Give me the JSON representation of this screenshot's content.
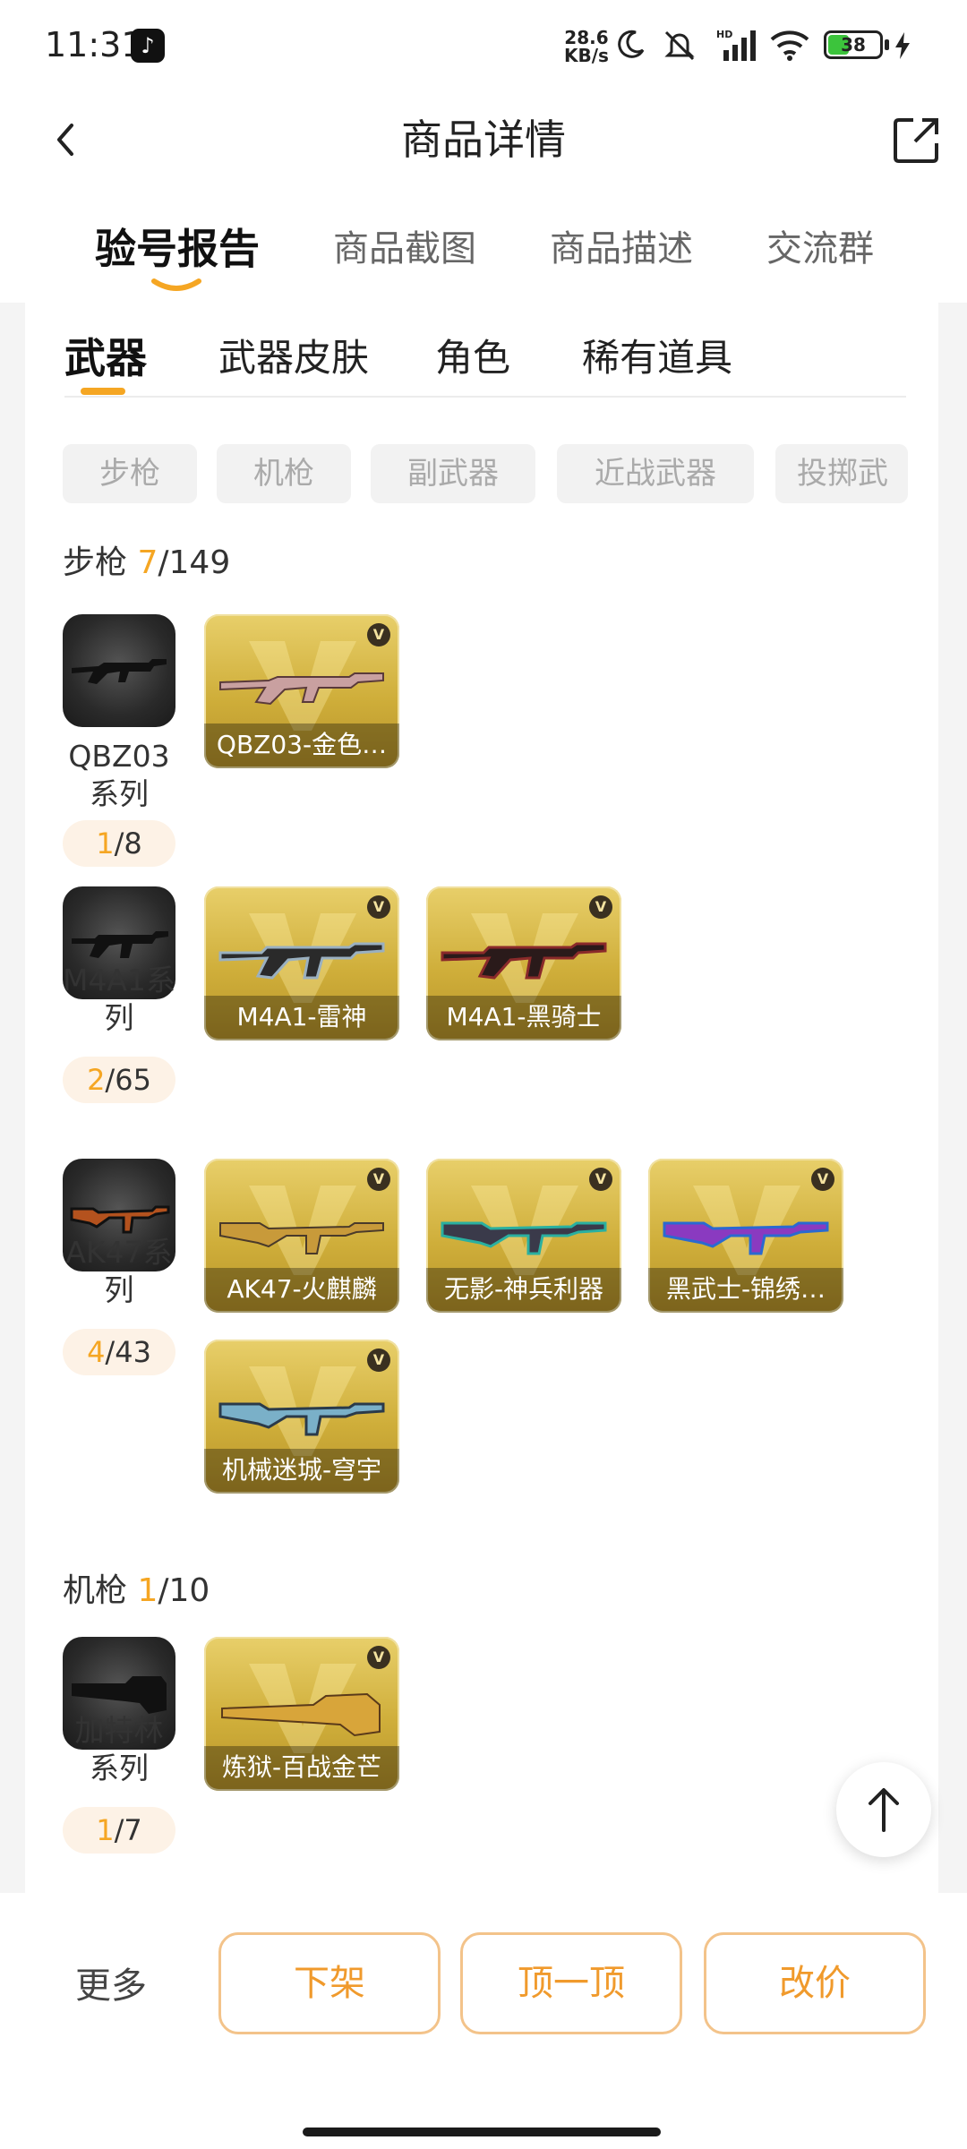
{
  "status_bar": {
    "time": "11:31",
    "net_speed_value": "28.6",
    "net_speed_unit": "KB/s",
    "battery": "38"
  },
  "nav": {
    "title": "商品详情"
  },
  "main_tabs": [
    "验号报告",
    "商品截图",
    "商品描述",
    "交流群"
  ],
  "sub_tabs": [
    "武器",
    "武器皮肤",
    "角色",
    "稀有道具"
  ],
  "chips": [
    "步枪",
    "机枪",
    "副武器",
    "近战武器",
    "投掷武"
  ],
  "sections": [
    {
      "title": "步枪",
      "owned": "7",
      "total": "/149",
      "series": [
        {
          "name_line1": "QBZ03",
          "name_line2": "系列",
          "owned": "1",
          "total": "/8",
          "skins": [
            "QBZ03-金色…"
          ]
        },
        {
          "name_line1": "M4A1系",
          "name_line2": "列",
          "owned": "2",
          "total": "/65",
          "skins": [
            "M4A1-雷神",
            "M4A1-黑骑士"
          ]
        },
        {
          "name_line1": "AK47系",
          "name_line2": "列",
          "owned": "4",
          "total": "/43",
          "skins": [
            "AK47-火麒麟",
            "无影-神兵利器",
            "黑武士-锦绣…",
            "机械迷城-穹宇"
          ]
        }
      ]
    },
    {
      "title": "机枪",
      "owned": "1",
      "total": "/10",
      "series": [
        {
          "name_line1": "加特林",
          "name_line2": "系列",
          "owned": "1",
          "total": "/7",
          "skins": [
            "炼狱-百战金芒"
          ]
        }
      ]
    }
  ],
  "skin_badge": "V",
  "bottom": {
    "more": "更多",
    "actions": [
      "下架",
      "顶一顶",
      "改价"
    ]
  },
  "colors": {
    "accent": "#f5a623",
    "button_text": "#f09a2c",
    "card_gold": "#cfae3a"
  },
  "icons": [
    "tiktok-icon",
    "moon-icon",
    "mute-icon",
    "signal-icon",
    "wifi-icon",
    "battery-icon",
    "charge-icon",
    "back-arrow-icon",
    "share-icon",
    "scroll-top-icon"
  ]
}
